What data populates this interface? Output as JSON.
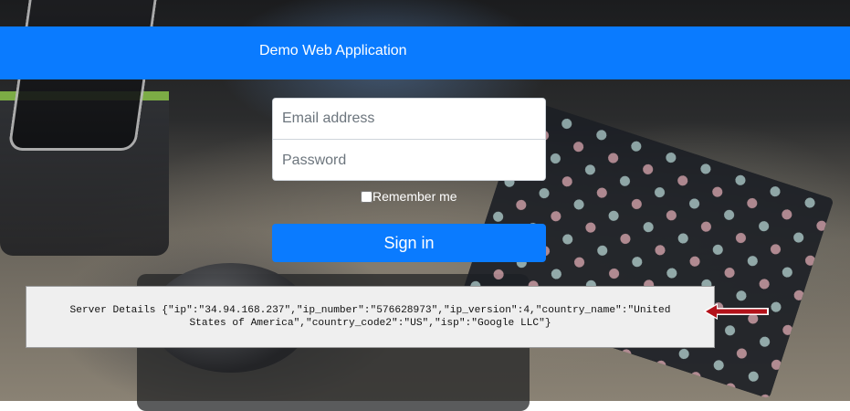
{
  "header": {
    "title": "Demo Web Application",
    "color": "#0a7bff"
  },
  "login_form": {
    "email_placeholder": "Email address",
    "password_placeholder": "Password",
    "remember_label": "Remember me",
    "signin_label": "Sign in",
    "remember_checked": false
  },
  "server_details": {
    "text": "Server Details {\"ip\":\"34.94.168.237\",\"ip_number\":\"576628973\",\"ip_version\":4,\"country_name\":\"United States of America\",\"country_code2\":\"US\",\"isp\":\"Google LLC\"}"
  },
  "annotation": {
    "icon": "left-arrow-icon",
    "color": "#b3121a"
  }
}
